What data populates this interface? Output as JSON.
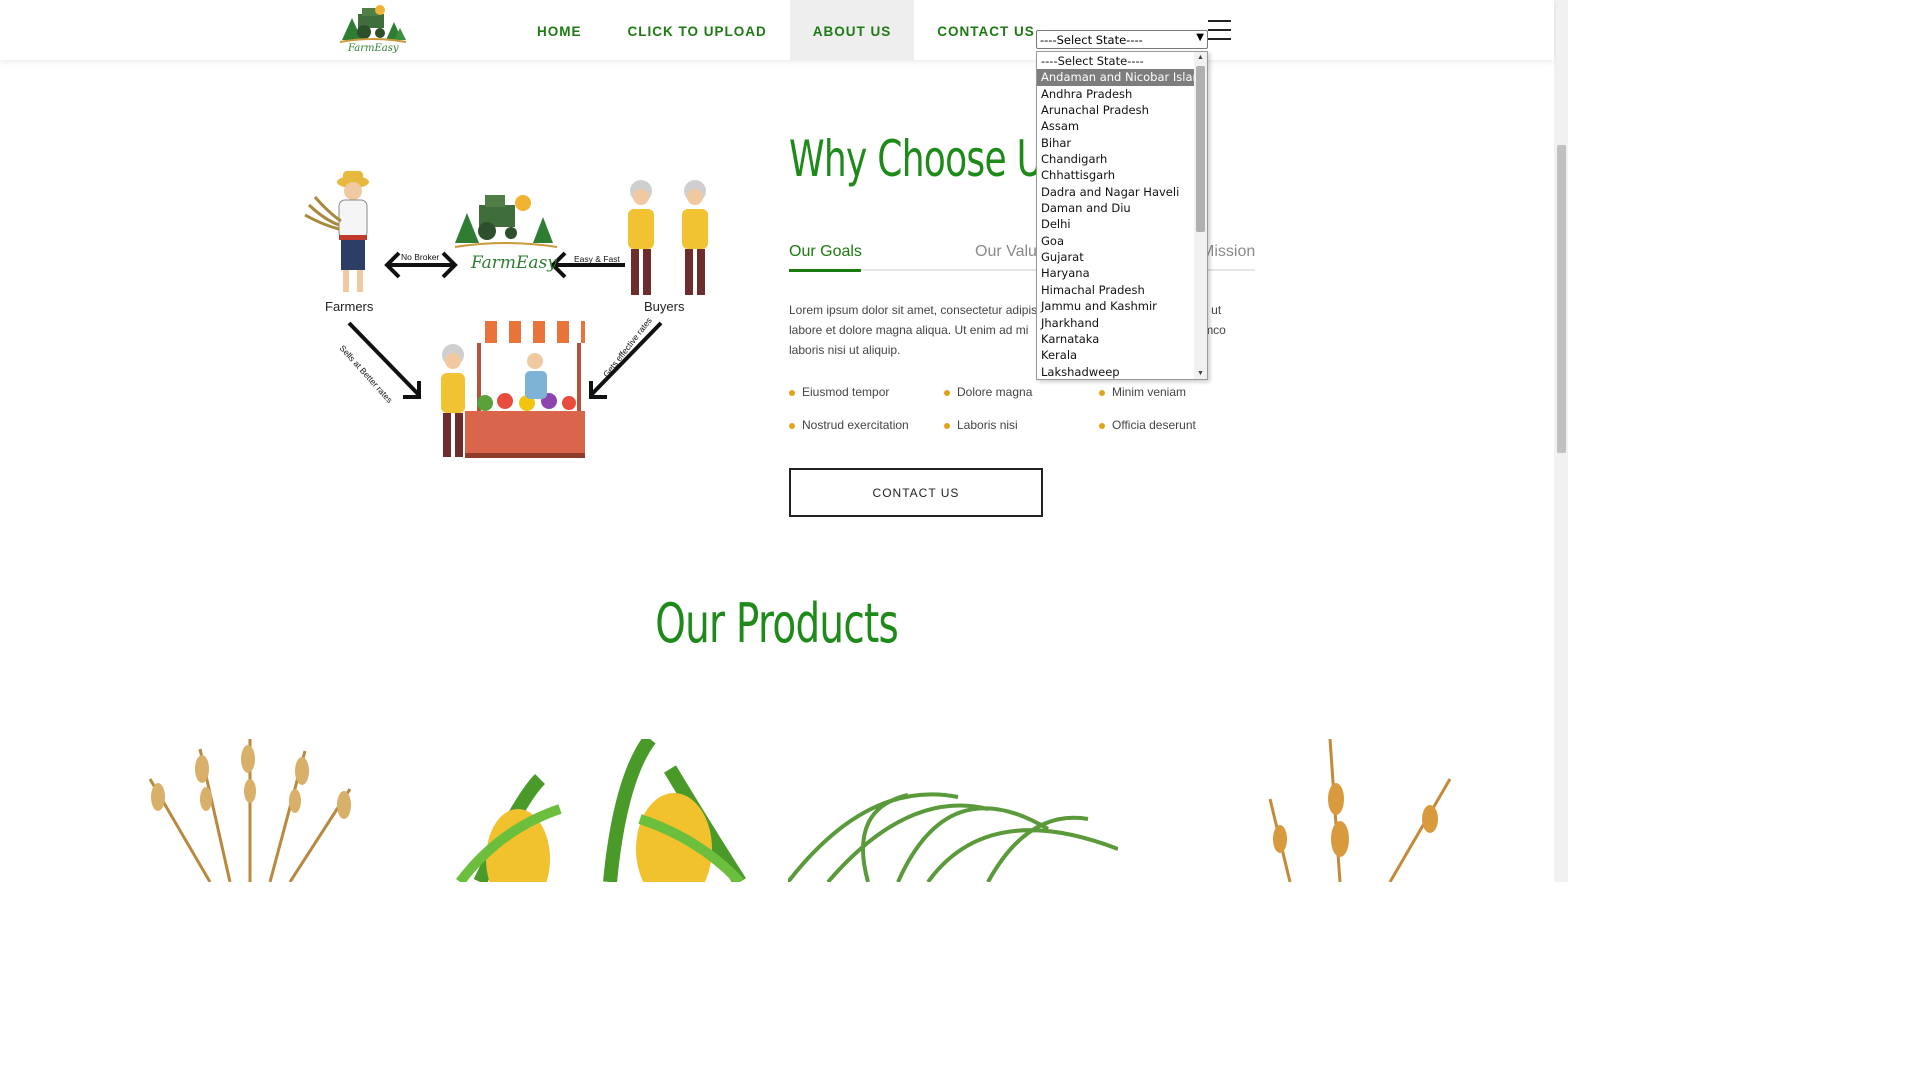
{
  "header": {
    "logo_text": "FarmEasy",
    "nav": [
      "HOME",
      "CLICK TO UPLOAD",
      "ABOUT US",
      "CONTACT US"
    ],
    "active_nav": "ABOUT US",
    "state_select_value": "----Select State----"
  },
  "dropdown": {
    "options": [
      "----Select State----",
      "Andaman and Nicobar Islands",
      "Andhra Pradesh",
      "Arunachal Pradesh",
      "Assam",
      "Bihar",
      "Chandigarh",
      "Chhattisgarh",
      "Dadra and Nagar Haveli",
      "Daman and Diu",
      "Delhi",
      "Goa",
      "Gujarat",
      "Haryana",
      "Himachal Pradesh",
      "Jammu and Kashmir",
      "Jharkhand",
      "Karnataka",
      "Kerala",
      "Lakshadweep"
    ],
    "highlighted": "Andaman and Nicobar Islands"
  },
  "illustration": {
    "farmers_label": "Farmers",
    "buyers_label": "Buyers",
    "no_broker_label": "No Broker",
    "easy_fast_label": "Easy & Fast",
    "sells_label": "Sells at Better rates",
    "gets_label": "Gets effective rates",
    "logo_text": "FarmEasy"
  },
  "why": {
    "title": "Why Choose Us:",
    "tabs": [
      "Our Goals",
      "Our Valu",
      "Mission"
    ],
    "active_tab": "Our Goals",
    "paragraph": "Lorem ipsum dolor sit amet, consectetur adipiscir                                   cididunt ut labore et dolore magna aliqua. Ut enim ad mi                                        tion ullamco laboris nisi ut aliquip.",
    "bullets": [
      "Eiusmod tempor",
      "Dolore magna",
      "Minim veniam",
      "Nostrud exercitation",
      "Laboris nisi",
      "Officia deserunt"
    ],
    "button": "CONTACT US"
  },
  "products": {
    "title": "Our Products",
    "items": [
      "wheat",
      "corn",
      "grass",
      "barley"
    ]
  },
  "colors": {
    "brand_green": "#1e8a1a",
    "nav_green": "#1e7a12",
    "bullet_gold": "#e0a31b",
    "active_nav_bg": "#eeeeee"
  }
}
